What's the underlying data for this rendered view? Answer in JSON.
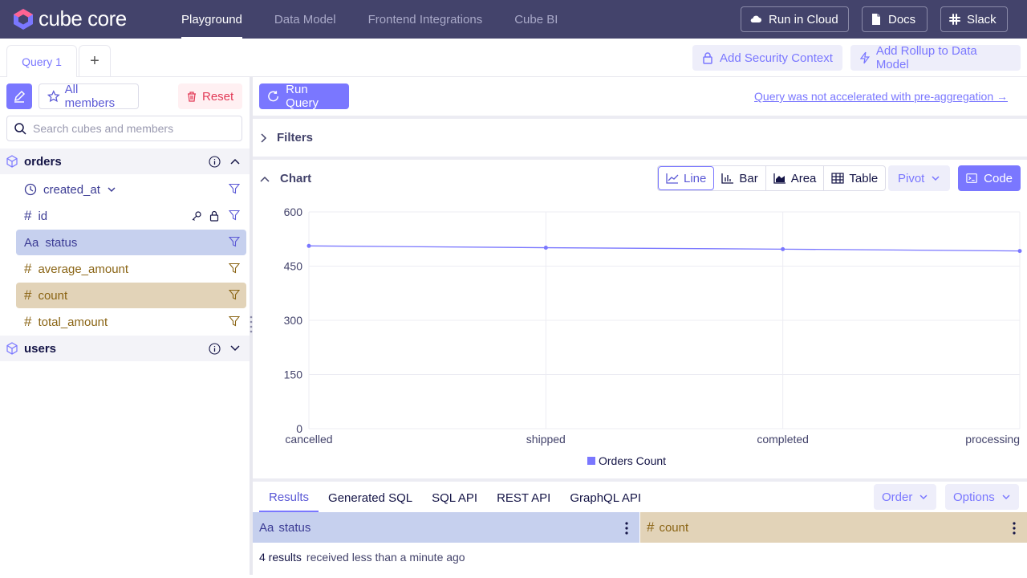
{
  "brand": {
    "name": "cube core"
  },
  "nav": [
    {
      "label": "Playground"
    },
    {
      "label": "Data Model"
    },
    {
      "label": "Frontend Integrations"
    },
    {
      "label": "Cube BI"
    }
  ],
  "top_buttons": {
    "run_cloud": "Run in Cloud",
    "docs": "Docs",
    "slack": "Slack"
  },
  "query_tabs": {
    "active": "Query 1",
    "add": "+"
  },
  "toolbar": {
    "security": "Add Security Context",
    "rollup": "Add Rollup to Data Model"
  },
  "sidebar": {
    "all_members": "All members",
    "reset": "Reset",
    "search_placeholder": "Search cubes and members",
    "cubes": [
      {
        "name": "orders",
        "expanded": true
      },
      {
        "name": "users",
        "expanded": false
      }
    ],
    "members": [
      {
        "label": "created_at",
        "kind": "time"
      },
      {
        "label": "id",
        "kind": "number-dimension"
      },
      {
        "label": "status",
        "kind": "string-dimension",
        "prefix": "Aa",
        "selected": true
      },
      {
        "label": "average_amount",
        "kind": "measure"
      },
      {
        "label": "count",
        "kind": "measure",
        "selected": true
      },
      {
        "label": "total_amount",
        "kind": "measure"
      }
    ]
  },
  "main": {
    "run_query": "Run Query",
    "preagg_link": "Query was not accelerated with pre-aggregation →",
    "filters_label": "Filters",
    "chart_label": "Chart",
    "chart_types": [
      "Line",
      "Bar",
      "Area",
      "Table"
    ],
    "active_chart_type": "Line",
    "pivot": "Pivot",
    "code": "Code"
  },
  "chart_data": {
    "type": "line",
    "categories": [
      "cancelled",
      "shipped",
      "completed",
      "processing"
    ],
    "series": [
      {
        "name": "Orders Count",
        "values": [
          506,
          501,
          497,
          492
        ],
        "color": "#7a77ff"
      }
    ],
    "ylim": [
      0,
      600
    ],
    "yticks": [
      "0",
      "150",
      "300",
      "450",
      "600"
    ],
    "grid": true,
    "legend": "bottom"
  },
  "results": {
    "tabs": [
      "Results",
      "Generated SQL",
      "SQL API",
      "REST API",
      "GraphQL API"
    ],
    "active_tab": "Results",
    "order": "Order",
    "options": "Options",
    "columns": [
      {
        "prefix": "Aa",
        "label": "status"
      },
      {
        "prefix": "#",
        "label": "count"
      }
    ],
    "count_text": "4 results",
    "time_text": "received less than a minute ago"
  },
  "colors": {
    "accent": "#7a77ff",
    "topbar": "#43436b",
    "dimension_bg": "#c6d0ee",
    "measure_bg": "#e2d3b8"
  }
}
